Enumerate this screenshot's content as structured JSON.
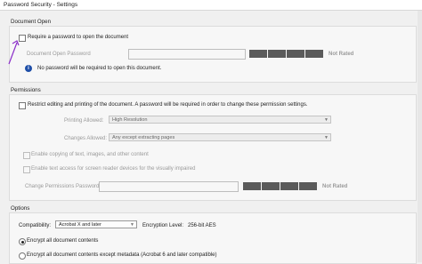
{
  "window": {
    "title": "Password Security - Settings"
  },
  "document_open": {
    "heading": "Document Open",
    "require_password_label": "Require a password to open the document",
    "password_field_label": "Document Open Password",
    "strength_text": "Not Rated",
    "info_text": "No password will be required to open this document."
  },
  "permissions": {
    "heading": "Permissions",
    "restrict_label": "Restrict editing and printing of the document. A password will be required in order to change these permission settings.",
    "printing_label": "Printing Allowed:",
    "printing_value": "High Resolution",
    "changes_label": "Changes Allowed:",
    "changes_value": "Any except extracting pages",
    "enable_copying_label": "Enable copying of text, images, and other content",
    "enable_access_label": "Enable text access for screen reader devices for the visually impaired",
    "change_password_label": "Change Permissions Password:",
    "strength_text": "Not Rated"
  },
  "options": {
    "heading": "Options",
    "compatibility_label": "Compatibility:",
    "compatibility_value": "Acrobat X and later",
    "encryption_label": "Encryption Level:",
    "encryption_value": "256-bit AES",
    "encrypt_all_label": "Encrypt all document contents",
    "encrypt_except_label": "Encrypt all document contents except metadata (Acrobat 6 and later compatible)"
  },
  "colors": {
    "annotation_arrow": "#8b2fc9",
    "info_icon": "#1f4fa8",
    "strength_bar": "#5b5b5b"
  },
  "icons": {
    "info": "info-icon",
    "dropdown": "chevron-down-icon"
  }
}
